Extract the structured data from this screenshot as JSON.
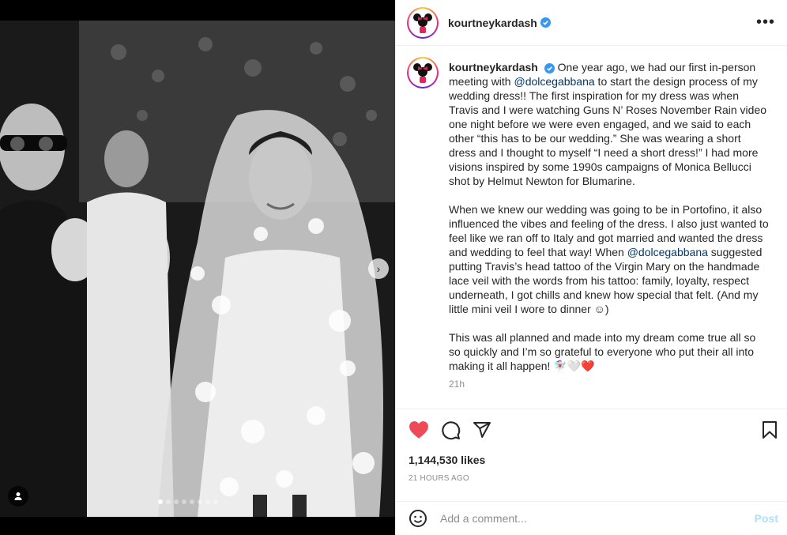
{
  "post": {
    "username": "kourtneykardash",
    "verified": true,
    "more_glyph": "•••",
    "carousel": {
      "slide_count": 8,
      "active_index": 0,
      "next_glyph": "›"
    }
  },
  "caption": {
    "username": "kourtneykardash",
    "para1_a": "One year ago, we had our first in-person meeting with ",
    "mention1": "@dolcegabbana",
    "para1_b": " to start the design process of my wedding dress!! The first inspiration for my dress was when Travis and I were watching Guns N’ Roses November Rain video one night before we were even engaged, and we said to each other “this has to be our wedding.” She was wearing a short dress and I thought to myself “I need a short dress!” I had more visions inspired by some 1990s campaigns of Monica Bellucci shot by Helmut Newton for Blumarine.",
    "para2_a": "When we knew our wedding was going to be in Portofino, it also influenced the vibes and feeling of the dress. I also just wanted to feel like we ran off to Italy and got married and wanted the dress and wedding to feel that way! When ",
    "mention2": "@dolcegabbana",
    "para2_b": " suggested putting Travis’s head tattoo of the Virgin Mary on the handmade lace veil with the words from his tattoo: family, loyalty, respect underneath, I got chills and knew how special that felt. (And my little mini veil I wore to dinner ☺)",
    "para3": "This was all planned and made into my dream come true all so so quickly and I’m so grateful to everyone who put their all into making it all happen! 🧚🏻‍♀️🤍❤️",
    "time": "21h"
  },
  "actions": {
    "liked": true,
    "like_icon": "heart-filled-icon",
    "comment_icon": "comment-icon",
    "share_icon": "paper-plane-icon",
    "save_icon": "bookmark-icon"
  },
  "likes_text": "1,144,530 likes",
  "posted_ago": "21 HOURS AGO",
  "comment": {
    "placeholder": "Add a comment...",
    "value": "",
    "post_label": "Post"
  },
  "colors": {
    "like_red": "#ed4956",
    "mention_blue": "#00376b",
    "verified_blue": "#3897f0",
    "post_disabled": "#b2dffc",
    "muted_gray": "#8e8e8e"
  }
}
